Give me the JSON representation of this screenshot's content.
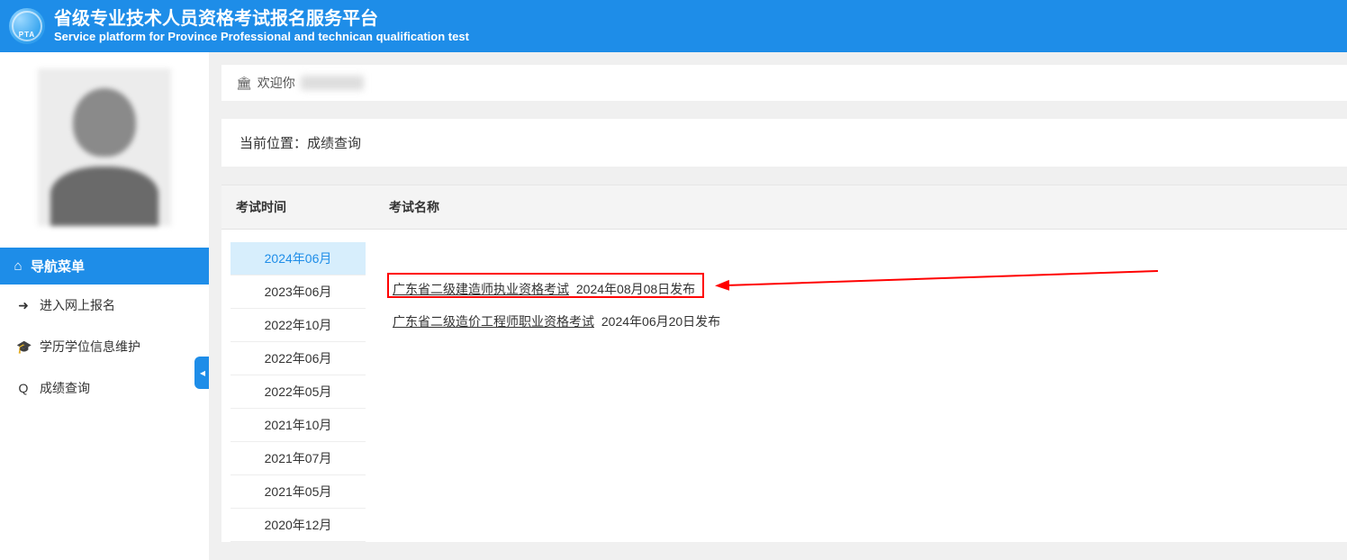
{
  "header": {
    "logo_text": "PTA",
    "title_cn": "省级专业技术人员资格考试报名服务平台",
    "title_en": "Service platform for Province Professional and technican qualification test"
  },
  "sidebar": {
    "nav_header": "导航菜单",
    "items": [
      {
        "icon": "➜",
        "label": "进入网上报名"
      },
      {
        "icon": "🎓",
        "label": "学历学位信息维护"
      },
      {
        "icon": "Q",
        "label": "成绩查询"
      }
    ],
    "collapse_glyph": "◂"
  },
  "welcome": {
    "icon": "🏛",
    "prefix": "欢迎你"
  },
  "crumb": {
    "label": "当前位置：",
    "value": "成绩查询"
  },
  "table": {
    "col1": "考试时间",
    "col2": "考试名称",
    "times": [
      "2024年06月",
      "2023年06月",
      "2022年10月",
      "2022年06月",
      "2022年05月",
      "2021年10月",
      "2021年07月",
      "2021年05月",
      "2020年12月"
    ],
    "active_index": 0,
    "exams": [
      {
        "name": "广东省二级建造师执业资格考试",
        "date": "2024年08月08日发布"
      },
      {
        "name": "广东省二级造价工程师职业资格考试",
        "date": "2024年06月20日发布"
      }
    ]
  }
}
